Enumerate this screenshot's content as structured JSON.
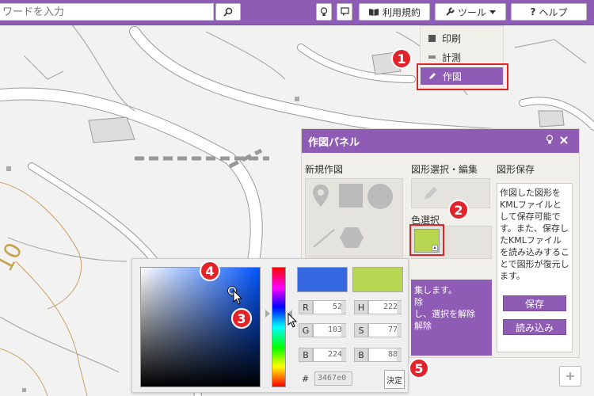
{
  "toolbar": {
    "search_placeholder": "ワードを入力",
    "terms_label": "利用規約",
    "tools_label": "ツール",
    "help_label": "ヘルプ",
    "help_glyph": "?"
  },
  "tool_menu": {
    "items": [
      {
        "label": "印刷"
      },
      {
        "label": "計測"
      },
      {
        "label": "作図"
      }
    ]
  },
  "draw_panel": {
    "title": "作図パネル",
    "new_drawing": "新規作図",
    "edit_title": "図形選択・編集",
    "save_title": "図形保存",
    "color_select": "色選択",
    "save_description": "作図した図形をKMLファイルとして保存可能です。また、保存したKMLファイルを読み込みすることで図形が復元します。",
    "save_button": "保存",
    "load_button": "読み込み",
    "info_lines": [
      "集します。",
      "除",
      "し、選択を解除",
      "解除"
    ]
  },
  "color_picker": {
    "fields": [
      {
        "label": "R",
        "value": "52"
      },
      {
        "label": "G",
        "value": "103"
      },
      {
        "label": "B",
        "value": "224"
      },
      {
        "label": "H",
        "value": "222"
      },
      {
        "label": "S",
        "value": "77"
      },
      {
        "label": "B",
        "value": "88"
      }
    ],
    "hex_label": "#",
    "hex_value": "3467e0",
    "confirm_button": "決定"
  },
  "map_label": "10",
  "badges": [
    "1",
    "2",
    "3",
    "4",
    "5"
  ],
  "colors": {
    "brand_purple": "#8e5bb5",
    "badge_red": "#e2242a",
    "current_color": "#3467e0",
    "previous_color": "#b7d651"
  },
  "icons": {
    "search": "magnifier-icon",
    "bulb": "lightbulb-icon",
    "comment": "comment-icon",
    "book": "book-icon",
    "wrench": "wrench-icon",
    "pencil": "pencil-icon",
    "close": "close-icon",
    "zoom_in": "plus-icon"
  }
}
